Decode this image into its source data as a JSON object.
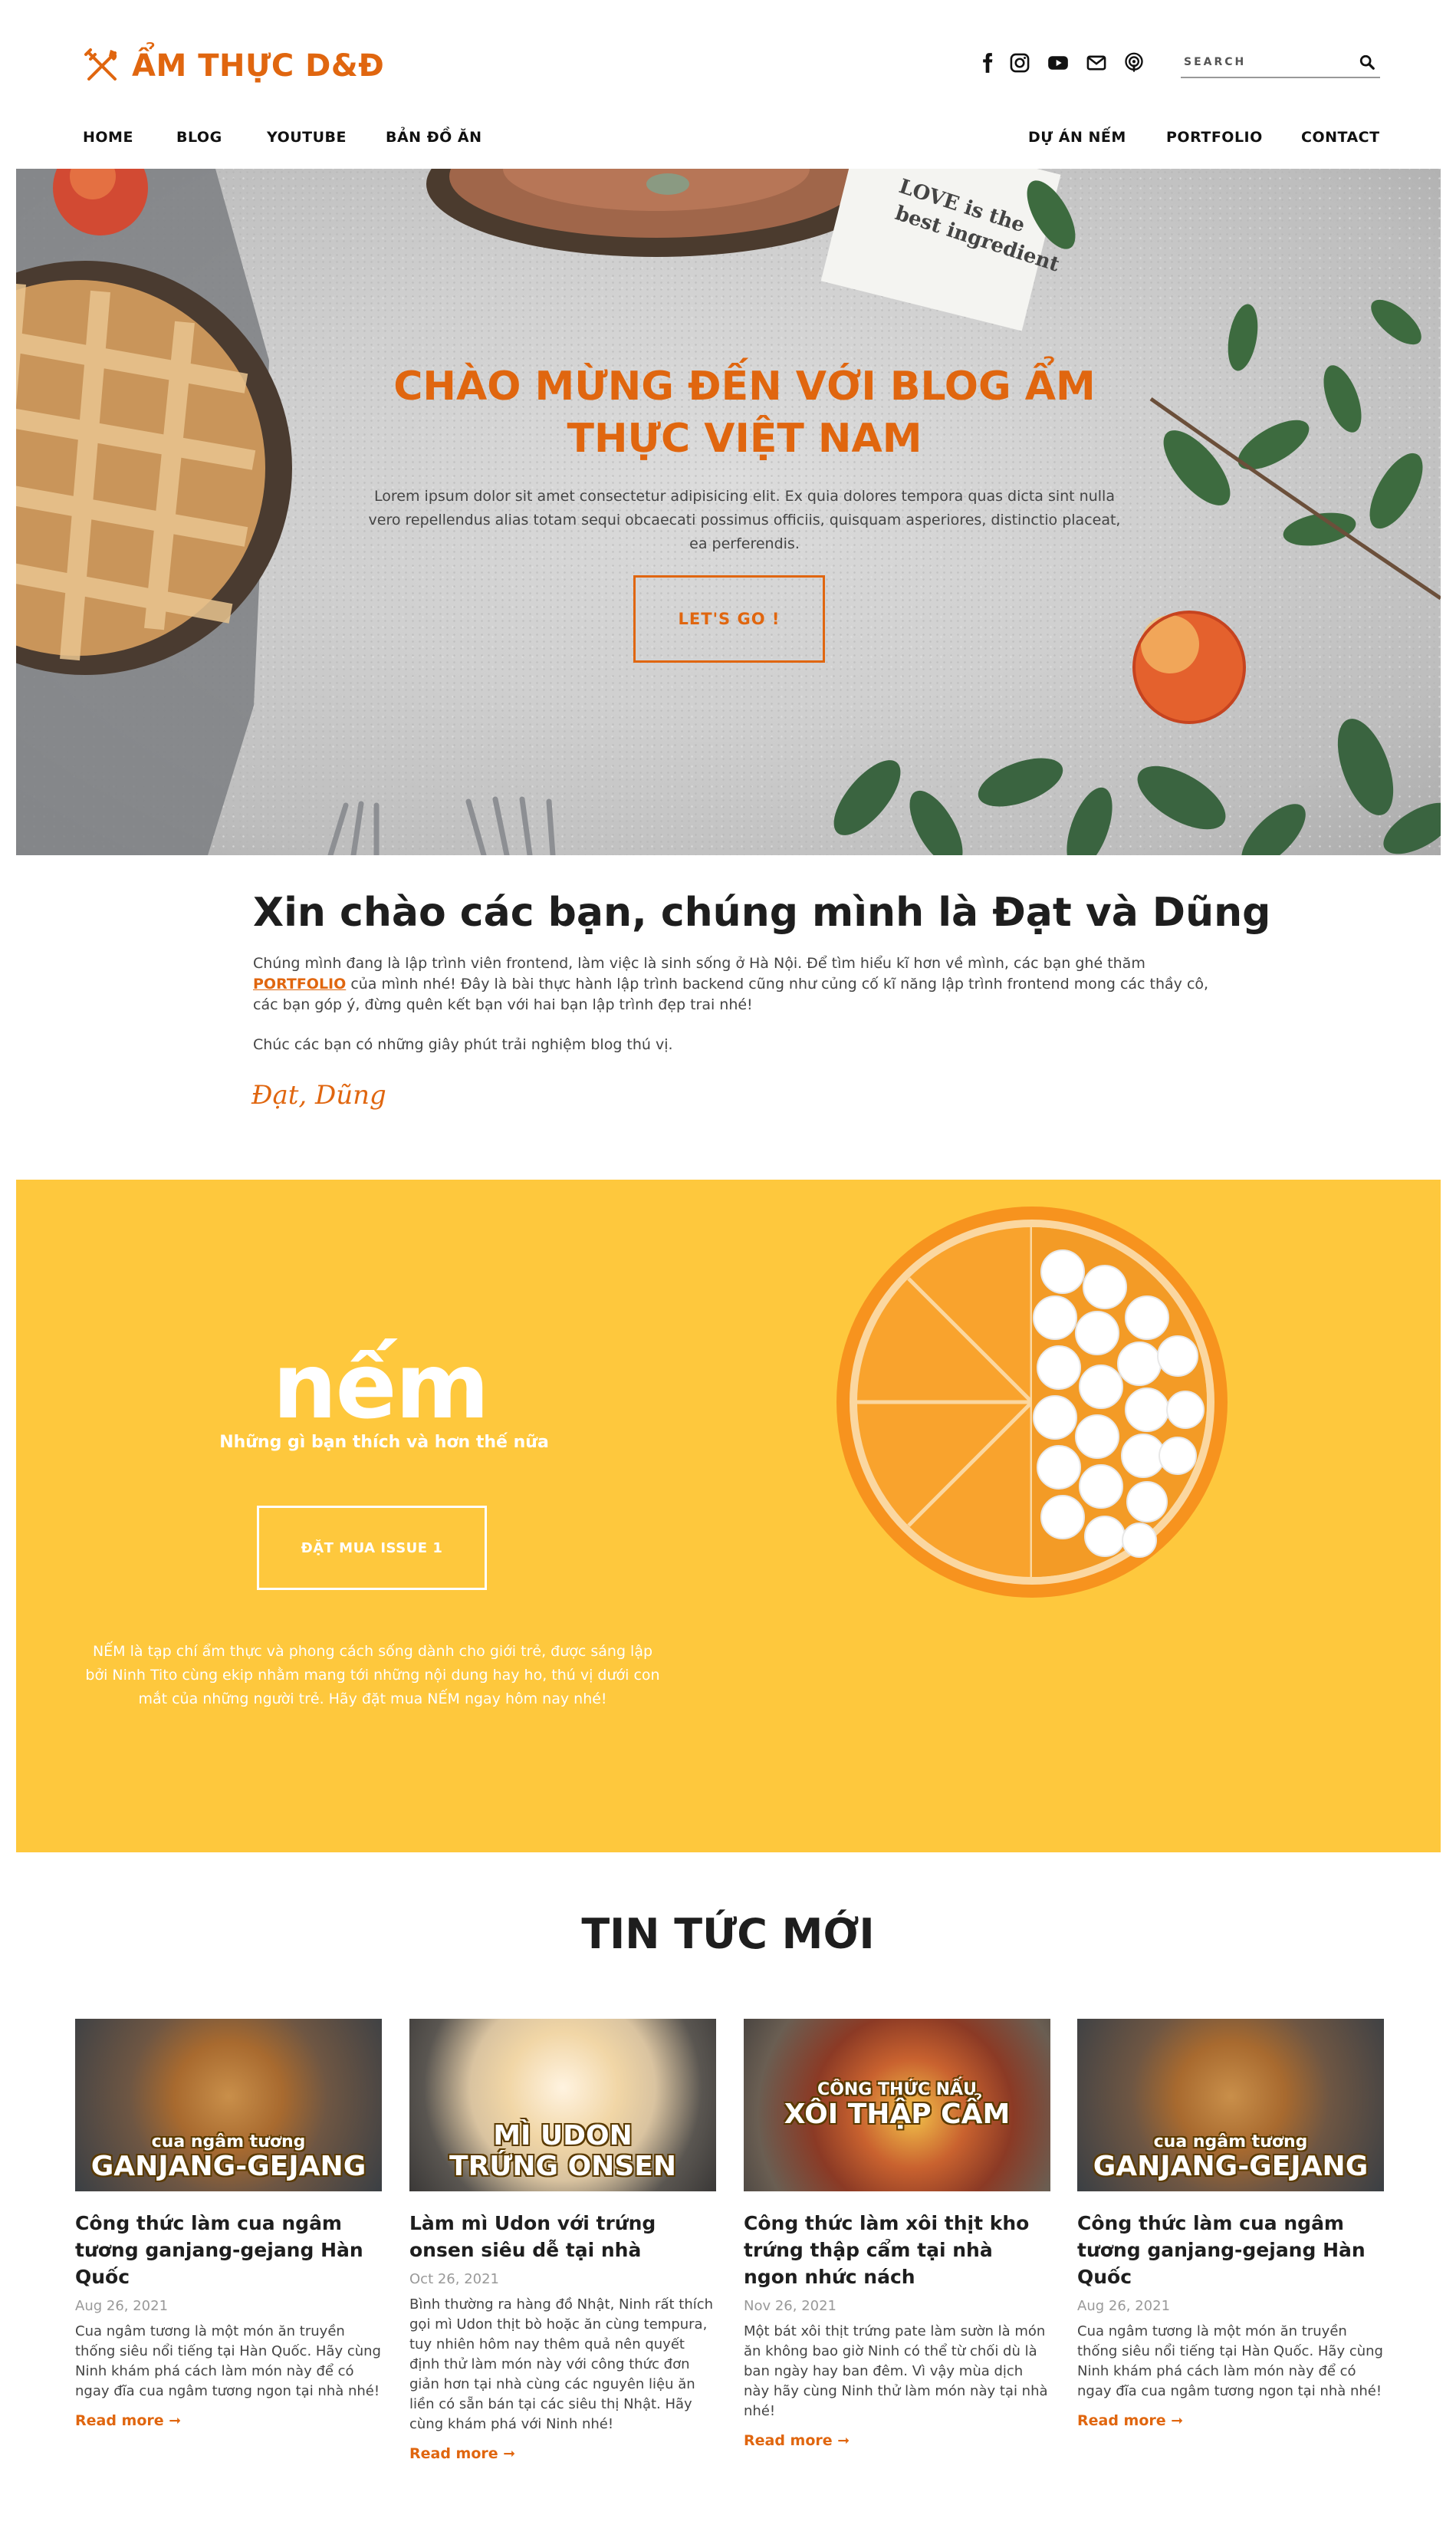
{
  "brand": {
    "name": "ẨM THỰC D&Đ",
    "icon": "fork-knife-icon",
    "accent": "#e0660f"
  },
  "social": [
    "facebook-icon",
    "instagram-icon",
    "youtube-icon",
    "email-icon",
    "podcast-icon"
  ],
  "search": {
    "placeholder": "SEARCH"
  },
  "nav_left": [
    "HOME",
    "BLOG",
    "YOUTUBE",
    "BẢN ĐỒ ĂN"
  ],
  "nav_right": [
    "DỰ ÁN NẾM",
    "PORTFOLIO",
    "CONTACT"
  ],
  "hero": {
    "title_line1": "CHÀO MỪNG ĐẾN VỚI BLOG ẨM",
    "title_line2": "THỰC VIỆT NAM",
    "text": "Lorem ipsum dolor sit amet consectetur adipisicing elit. Ex quia dolores tempora quas dicta sint nulla vero repellendus alias totam sequi obcaecati possimus officiis, quisquam asperiores, distinctio placeat, ea perferendis.",
    "button": "LET'S GO !",
    "napkin_text_1": "LOVE is the",
    "napkin_text_2": "best ingredient"
  },
  "intro": {
    "title": "Xin chào các bạn, chúng mình là Đạt và Dũng",
    "p1_before": "Chúng mình đang là lập trình viên frontend, làm việc là sinh sống ở Hà Nội. Để tìm hiểu kĩ hơn về mình, các bạn ghé thăm ",
    "p1_link": "PORTFOLIO",
    "p1_after": " của mình nhé! Đây là bài thực hành lập trình backend cũng như củng cố kĩ năng lập trình frontend mong các thầy cô, các bạn góp ý, đừng quên kết bạn với hai bạn lập trình đẹp trai nhé!",
    "p2": "Chúc các bạn có những giây phút trải nghiệm blog thú vị.",
    "signature": "Đạt, Dũng"
  },
  "nem": {
    "logo": "nếm",
    "subtitle": "Những gì bạn thích và hơn thế nữa",
    "button": "ĐẶT MUA ISSUE 1",
    "description": "NẾM là tạp chí ẩm thực và phong cách sống dành cho giới trẻ, được sáng lập bởi Ninh Tito cùng ekip nhằm mang tới những nội dung hay ho, thú vị dưới con mắt của những người trẻ. Hãy đặt mua NẾM ngay hôm nay nhé!",
    "bg_color": "#fec83d"
  },
  "news": {
    "title": "TIN TỨC MỚI",
    "read_more": "Read more ➞",
    "cards": [
      {
        "cap_small": "cua ngâm tương",
        "cap_big": "GANJANG-GEJANG",
        "title": "Công thức làm cua ngâm tương ganjang-gejang Hàn Quốc",
        "date": "Aug 26, 2021",
        "excerpt": "Cua ngâm tương là một món ăn truyền thống siêu nổi tiếng tại Hàn Quốc. Hãy cùng Ninh khám phá cách làm món này để có ngay đĩa cua ngâm tương ngon tại nhà nhé!"
      },
      {
        "cap_small": "MÌ UDON",
        "cap_big": "TRỨNG ONSEN",
        "title": "Làm mì Udon với trứng onsen siêu dễ tại nhà",
        "date": "Oct 26, 2021",
        "excerpt": "Bình thường ra hàng đồ Nhật, Ninh rất thích gọi mì Udon thịt bò hoặc ăn cùng tempura, tuy nhiên hôm nay thêm quả nên quyết định thử làm món này với công thức đơn giản hơn tại nhà cùng các nguyên liệu ăn liền có sẵn bán tại các siêu thị Nhật. Hãy cùng khám phá với Ninh nhé!"
      },
      {
        "cap_small": "CÔNG THỨC NẤU",
        "cap_big": "XÔI THẬP CẨM",
        "title": "Công thức làm xôi thịt kho trứng thập cẩm tại nhà ngon nhức nách",
        "date": "Nov 26, 2021",
        "excerpt": "Một bát xôi thịt trứng pate làm sườn là món ăn không bao giờ Ninh có thể từ chối dù là ban ngày hay ban đêm. Vì vậy mùa dịch này hãy cùng Ninh thử làm món này tại nhà nhé!"
      },
      {
        "cap_small": "cua ngâm tương",
        "cap_big": "GANJANG-GEJANG",
        "title": "Công thức làm cua ngâm tương ganjang-gejang Hàn Quốc",
        "date": "Aug 26, 2021",
        "excerpt": "Cua ngâm tương là một món ăn truyền thống siêu nổi tiếng tại Hàn Quốc. Hãy cùng Ninh khám phá cách làm món này để có ngay đĩa cua ngâm tương ngon tại nhà nhé!"
      }
    ]
  }
}
